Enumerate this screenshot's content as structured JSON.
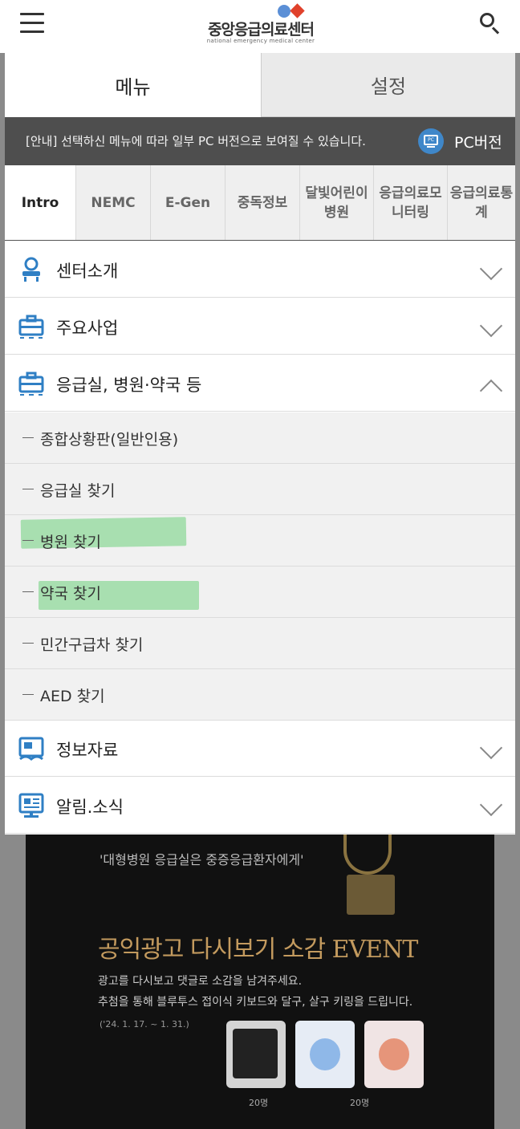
{
  "header": {
    "logo_title": "중앙응급의료센터",
    "logo_sub": "national emergency medical center",
    "menu_icon": "hamburger-icon",
    "search_icon": "search-icon"
  },
  "tabs": {
    "menu": "메뉴",
    "settings": "설정"
  },
  "notice": {
    "text": "[안내] 선택하신 메뉴에 따라 일부 PC 버전으로 보여질 수 있습니다.",
    "pc_icon_text": "PC",
    "pc_label": "PC버전"
  },
  "categories": [
    {
      "label": "Intro"
    },
    {
      "label": "NEMC"
    },
    {
      "label": "E-Gen"
    },
    {
      "label": "중독정보"
    },
    {
      "label": "달빛어린이병원"
    },
    {
      "label": "응급의료모니터링"
    },
    {
      "label": "응급의료통계"
    }
  ],
  "menu": {
    "items": [
      {
        "label": "센터소개",
        "icon": "chair-icon"
      },
      {
        "label": "주요사업",
        "icon": "briefcase-icon"
      },
      {
        "label": "응급실, 병원·약국 등",
        "icon": "briefcase-icon"
      },
      {
        "label": "정보자료",
        "icon": "book-icon"
      },
      {
        "label": "알림.소식",
        "icon": "notice-board-icon"
      }
    ],
    "sub_items": [
      {
        "label": "종합상황판(일반인용)"
      },
      {
        "label": "응급실 찾기"
      },
      {
        "label": "병원 찾기"
      },
      {
        "label": "약국 찾기"
      },
      {
        "label": "민간구급차 찾기"
      },
      {
        "label": "AED 찾기"
      }
    ]
  },
  "banner": {
    "quote": "'대형병원 응급실은 중증응급환자에게'",
    "title": "공익광고 다시보기 소감 EVENT",
    "desc1": "광고를 다시보고 댓글로 소감을 남겨주세요.",
    "desc2": "추첨을 통해 블루투스 접이식 키보드와 달구, 살구 키링을 드립니다.",
    "date": "('24. 1. 17. ~ 1. 31.)",
    "count1": "20명",
    "count2": "20명"
  },
  "colors": {
    "notice_bg": "#4e4e4e",
    "icon_blue": "#2f7fc4",
    "highlight": "#8fd89a",
    "banner_title": "#c39a5e"
  }
}
